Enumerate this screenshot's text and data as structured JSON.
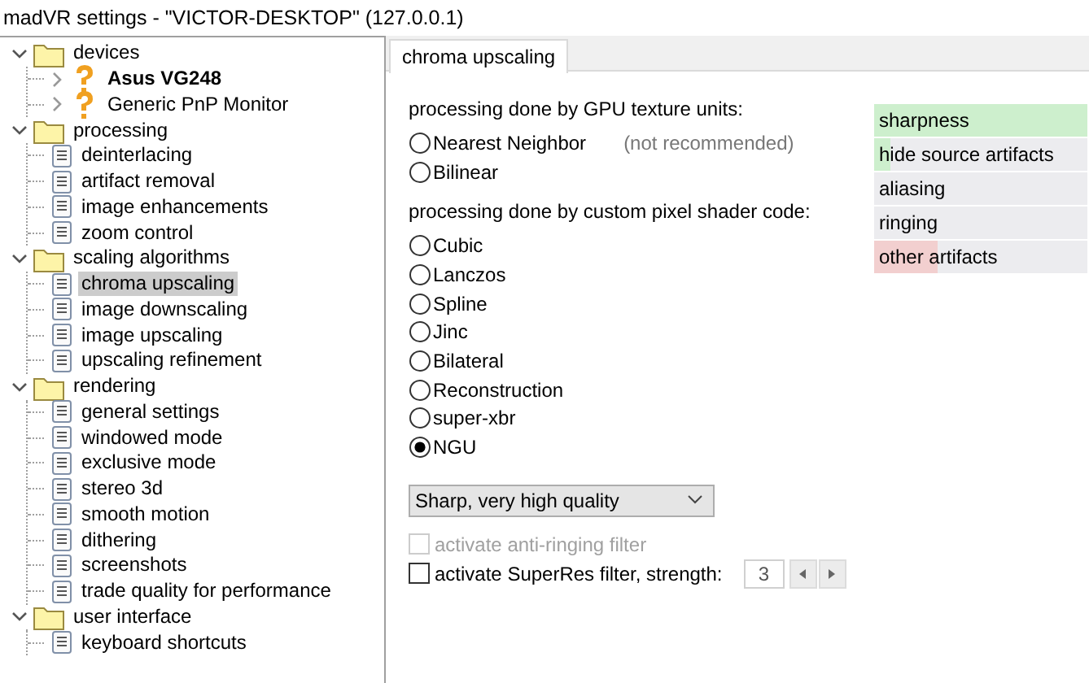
{
  "window": {
    "title": "madVR settings - \"VICTOR-DESKTOP\" (127.0.0.1)"
  },
  "tree": [
    {
      "label": "devices",
      "kind": "folder",
      "expanded": true,
      "selected": false,
      "children": [
        {
          "label": "Asus VG248",
          "kind": "device",
          "expanded": false,
          "active": true,
          "selected": false
        },
        {
          "label": "Generic PnP Monitor",
          "kind": "device",
          "expanded": false,
          "active": false,
          "selected": false
        }
      ]
    },
    {
      "label": "processing",
      "kind": "folder",
      "expanded": true,
      "selected": false,
      "children": [
        {
          "label": "deinterlacing",
          "kind": "page",
          "selected": false
        },
        {
          "label": "artifact removal",
          "kind": "page",
          "selected": false
        },
        {
          "label": "image enhancements",
          "kind": "page",
          "selected": false
        },
        {
          "label": "zoom control",
          "kind": "page",
          "selected": false
        }
      ]
    },
    {
      "label": "scaling algorithms",
      "kind": "folder",
      "expanded": true,
      "selected": false,
      "children": [
        {
          "label": "chroma upscaling",
          "kind": "page",
          "selected": true
        },
        {
          "label": "image downscaling",
          "kind": "page",
          "selected": false
        },
        {
          "label": "image upscaling",
          "kind": "page",
          "selected": false
        },
        {
          "label": "upscaling refinement",
          "kind": "page",
          "selected": false
        }
      ]
    },
    {
      "label": "rendering",
      "kind": "folder",
      "expanded": true,
      "selected": false,
      "children": [
        {
          "label": "general settings",
          "kind": "page",
          "selected": false
        },
        {
          "label": "windowed mode",
          "kind": "page",
          "selected": false
        },
        {
          "label": "exclusive mode",
          "kind": "page",
          "selected": false
        },
        {
          "label": "stereo 3d",
          "kind": "page",
          "selected": false
        },
        {
          "label": "smooth motion",
          "kind": "page",
          "selected": false
        },
        {
          "label": "dithering",
          "kind": "page",
          "selected": false
        },
        {
          "label": "screenshots",
          "kind": "page",
          "selected": false
        },
        {
          "label": "trade quality for performance",
          "kind": "page",
          "selected": false
        }
      ]
    },
    {
      "label": "user interface",
      "kind": "folder",
      "expanded": true,
      "selected": false,
      "children": [
        {
          "label": "keyboard shortcuts",
          "kind": "page",
          "selected": false
        }
      ]
    }
  ],
  "tabs": [
    {
      "label": "chroma upscaling",
      "selected": true
    }
  ],
  "groups": [
    {
      "heading": "processing done by GPU texture units:",
      "options": [
        {
          "label": "Nearest Neighbor",
          "note": "(not recommended)",
          "selected": false
        },
        {
          "label": "Bilinear",
          "selected": false
        }
      ]
    },
    {
      "heading": "processing done by custom pixel shader code:",
      "options": [
        {
          "label": "Cubic",
          "selected": false
        },
        {
          "label": "Lanczos",
          "selected": false
        },
        {
          "label": "Spline",
          "selected": false
        },
        {
          "label": "Jinc",
          "selected": false
        },
        {
          "label": "Bilateral",
          "selected": false
        },
        {
          "label": "Reconstruction",
          "selected": false
        },
        {
          "label": "super-xbr",
          "selected": false
        },
        {
          "label": "NGU",
          "selected": true
        }
      ]
    }
  ],
  "dropdown": {
    "value": "Sharp, very high quality"
  },
  "checkboxes": [
    {
      "label": "activate anti-ringing filter",
      "checked": false,
      "disabled": true
    },
    {
      "label": "activate SuperRes filter, strength:",
      "checked": false,
      "disabled": false,
      "spinner": {
        "value": "3"
      }
    }
  ],
  "quality": [
    {
      "label": "sharpness",
      "level": 1,
      "color": "#cdefcd"
    },
    {
      "label": "hide source artifacts",
      "level": 0.08,
      "color": "#cdefcd"
    },
    {
      "label": "aliasing"
    },
    {
      "label": "ringing"
    },
    {
      "label": "other artifacts",
      "level": 0.3,
      "color": "#f2cfcf"
    }
  ]
}
